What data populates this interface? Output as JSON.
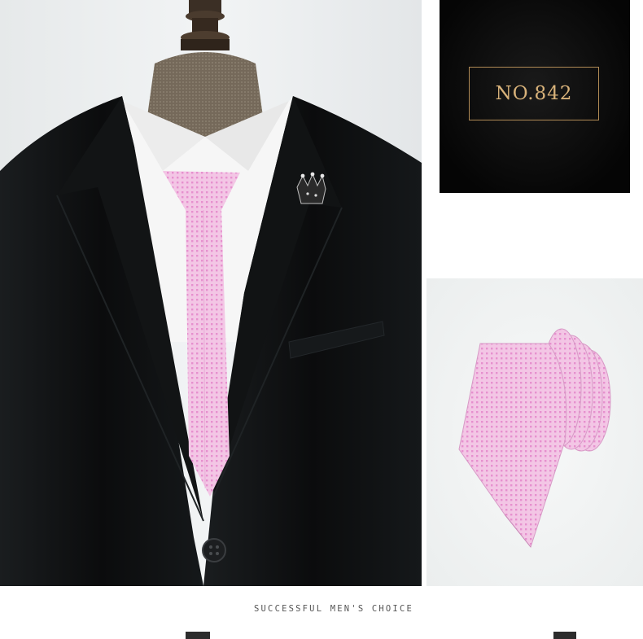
{
  "product_number": "NO.842",
  "tagline": "SUCCESSFUL MEN'S CHOICE",
  "colors": {
    "suit": "#0d0f10",
    "shirt": "#f6f6f6",
    "tie": "#f1c2e2",
    "tie_dots": "#e892cf",
    "gold": "#d8b27a",
    "card_bg": "#070707"
  },
  "icons": [
    "crown-lapel-pin-icon",
    "suit-button-icon"
  ]
}
